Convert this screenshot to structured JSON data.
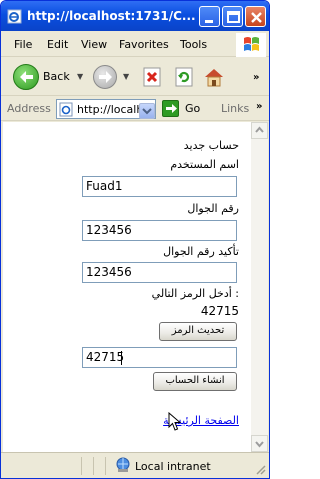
{
  "window": {
    "title": "http://localhost:1731/C..."
  },
  "menu": {
    "items": [
      "File",
      "Edit",
      "View",
      "Favorites",
      "Tools"
    ]
  },
  "toolbar": {
    "back_label": "Back"
  },
  "address": {
    "label": "Address",
    "url": "http://localho",
    "go_label": "Go",
    "links_label": "Links"
  },
  "form": {
    "heading": "حساب جديد",
    "username_label": "اسم المستخدم",
    "username_value": "Fuad1",
    "mobile_label": "رقم الجوال",
    "mobile_value": "123456",
    "mobile_confirm_label": "تأكيد رقم الجوال",
    "mobile_confirm_value": "123456",
    "captcha_label": ": أدخل الرمز التالي",
    "captcha_code": "42715",
    "refresh_code_label": "تحديث الرمز",
    "captcha_value": "42715",
    "create_account_label": "انشاء الحساب",
    "home_link": "الصفحة الرئيسية"
  },
  "status": {
    "zone": "Local intranet"
  },
  "colors": {
    "titlebar": "#0a4fe0",
    "link": "#0000ee",
    "chrome": "#ece9d8"
  }
}
